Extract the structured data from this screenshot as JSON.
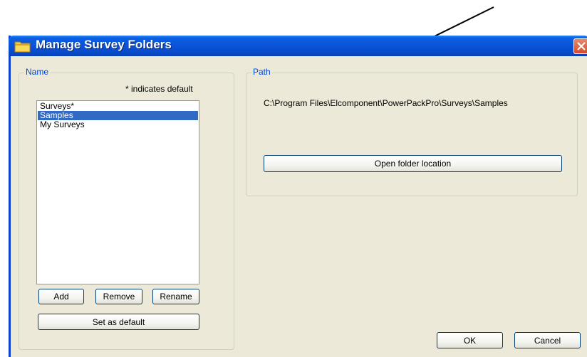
{
  "window": {
    "title": "Manage Survey Folders"
  },
  "name_group": {
    "legend": "Name",
    "hint": "* indicates default",
    "items": [
      {
        "label": "Surveys*",
        "selected": false
      },
      {
        "label": "Samples",
        "selected": true
      },
      {
        "label": "My Surveys",
        "selected": false
      }
    ],
    "add_label": "Add",
    "remove_label": "Remove",
    "rename_label": "Rename",
    "set_default_label": "Set as default"
  },
  "path_group": {
    "legend": "Path",
    "path": "C:\\Program Files\\Elcomponent\\PowerPackPro\\Surveys\\Samples",
    "open_label": "Open folder location"
  },
  "footer": {
    "ok_label": "OK",
    "cancel_label": "Cancel"
  },
  "icons": {
    "title": "folder-icon",
    "close": "close-icon"
  },
  "colors": {
    "titlebar": "#0a53d8",
    "dialog_bg": "#ece9d8",
    "selection": "#316ac5",
    "legend_text": "#0046d5",
    "close_button": "#d8492a"
  }
}
